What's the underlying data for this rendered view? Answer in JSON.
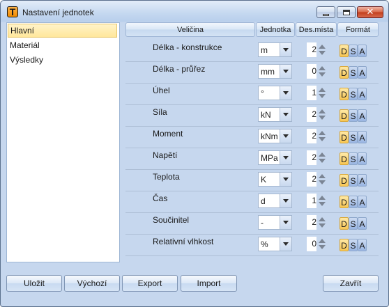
{
  "window": {
    "title": "Nastavení jednotek",
    "icon_letter": "T",
    "close_glyph": "✕"
  },
  "sidebar": {
    "items": [
      {
        "label": "Hlavní",
        "active": true
      },
      {
        "label": "Materiál",
        "active": false
      },
      {
        "label": "Výsledky",
        "active": false
      }
    ]
  },
  "grid": {
    "columns": {
      "quantity": "Veličina",
      "unit": "Jednotka",
      "decimals": "Des.místa",
      "format": "Formát"
    },
    "format_letters": [
      "D",
      "S",
      "A"
    ],
    "rows": [
      {
        "label": "Délka - konstrukce",
        "unit": "m",
        "decimals": "2",
        "format": "D"
      },
      {
        "label": "Délka - průřez",
        "unit": "mm",
        "decimals": "0",
        "format": "D"
      },
      {
        "label": "Úhel",
        "unit": "°",
        "decimals": "1",
        "format": "D"
      },
      {
        "label": "Síla",
        "unit": "kN",
        "decimals": "2",
        "format": "D"
      },
      {
        "label": "Moment",
        "unit": "kNm",
        "decimals": "2",
        "format": "D"
      },
      {
        "label": "Napětí",
        "unit": "MPa",
        "decimals": "2",
        "format": "D"
      },
      {
        "label": "Teplota",
        "unit": "K",
        "decimals": "2",
        "format": "D"
      },
      {
        "label": "Čas",
        "unit": "d",
        "decimals": "1",
        "format": "D"
      },
      {
        "label": "Součinitel",
        "unit": "-",
        "decimals": "2",
        "format": "D"
      },
      {
        "label": "Relativní vlhkost",
        "unit": "%",
        "decimals": "0",
        "format": "D"
      }
    ]
  },
  "buttons": {
    "save": "Uložit",
    "default": "Výchozí",
    "export": "Export",
    "import": "Import",
    "close": "Zavřít"
  },
  "colors": {
    "selected_format": "#f7c654",
    "unselected_format": "#99b5e2",
    "sidebar_active": "#ffe79b"
  }
}
